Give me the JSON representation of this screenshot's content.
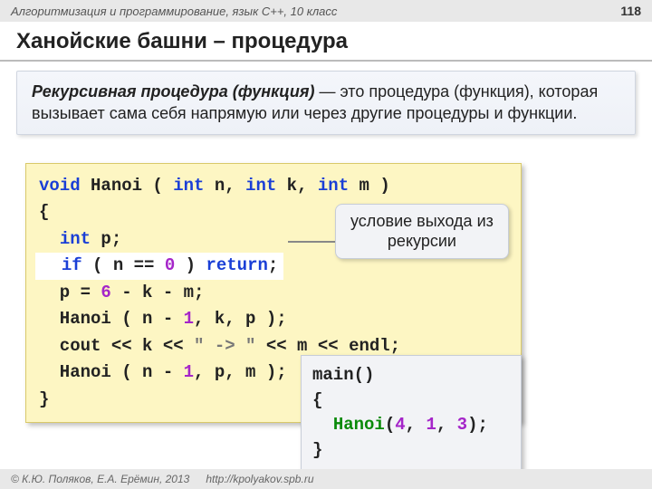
{
  "header": {
    "course": "Алгоритмизация и программирование, язык  C++, 10 класс",
    "page": "118"
  },
  "title": "Ханойские башни – процедура",
  "definition": {
    "term": "Рекурсивная процедура (функция)",
    "rest": " — это процедура (функция), которая вызывает сама себя напрямую или через другие процедуры и функции."
  },
  "code": {
    "l1_void": "void",
    "l1_name": " Hanoi ( ",
    "l1_int1": "int",
    "l1_n": " n, ",
    "l1_int2": "int",
    "l1_k": " k, ",
    "l1_int3": "int",
    "l1_m": " m )",
    "l2": "{",
    "l3_pad": "  ",
    "l3_int": "int",
    "l3_p": " p;",
    "l4_pad": "  ",
    "l4_if": "if",
    "l4_mid": " ( n == ",
    "l4_zero": "0",
    "l4_mid2": " ) ",
    "l4_return": "return",
    "l4_semi": ";",
    "l5a": "  p = ",
    "l5_six": "6",
    "l5b": " - k - m;",
    "l6a": "  Hanoi ( n - ",
    "l6_one": "1",
    "l6b": ", k, p );",
    "l7a": "  cout << k << ",
    "l7_str": "\" -> \"",
    "l7b": " << m << endl;",
    "l8a": "  Hanoi ( n - ",
    "l8_one": "1",
    "l8b": ", p, m );",
    "l9": "}"
  },
  "callout": {
    "line1": "условие выхода из",
    "line2": "рекурсии"
  },
  "main": {
    "l1": "main()",
    "l2": "{",
    "l3a": "  ",
    "l3_hanoi": "Hanoi",
    "l3b": "(",
    "l3_n1": "4",
    "l3c": ", ",
    "l3_n2": "1",
    "l3d": ", ",
    "l3_n3": "3",
    "l3e": ");",
    "l4": "}"
  },
  "footer": {
    "authors": "© К.Ю. Поляков, Е.А. Ерёмин, 2013",
    "url": "http://kpolyakov.spb.ru"
  }
}
